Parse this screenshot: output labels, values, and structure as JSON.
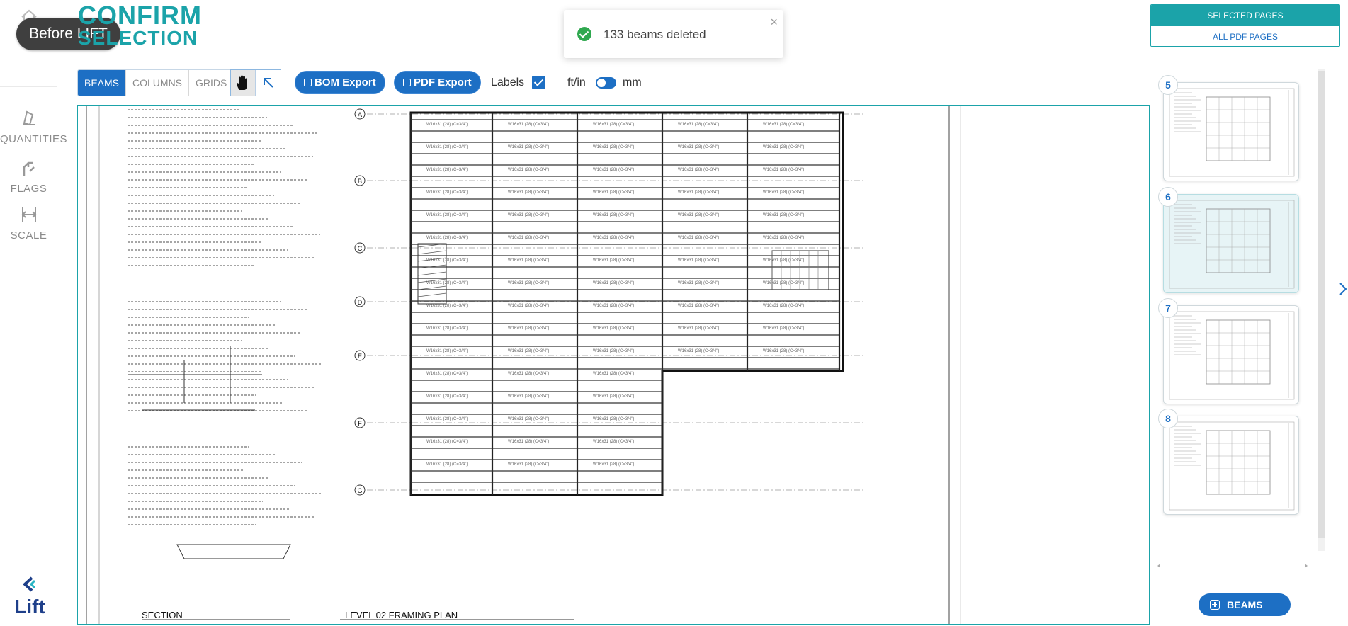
{
  "app": {
    "badge": "Before LIFT",
    "logo_text": "Lift"
  },
  "title": {
    "line1": "CONFIRM",
    "line2": "SELECTION"
  },
  "sidebar": {
    "items": [
      {
        "label": "QUANTITIES",
        "icon": "quantities-icon"
      },
      {
        "label": "FLAGS",
        "icon": "flags-icon"
      },
      {
        "label": "SCALE",
        "icon": "scale-icon"
      }
    ]
  },
  "toast": {
    "message": "133 beams deleted",
    "close": "×"
  },
  "toolbar": {
    "tabs": [
      {
        "label": "BEAMS",
        "active": true
      },
      {
        "label": "COLUMNS",
        "active": false
      },
      {
        "label": "GRIDS",
        "active": false
      }
    ],
    "bom_export": "BOM Export",
    "pdf_export": "PDF Export",
    "labels": "Labels",
    "labels_checked": true,
    "unit_left": "ft/in",
    "unit_right": "mm"
  },
  "drawing": {
    "section_caption": "SECTION",
    "plan_caption": "LEVEL 02 FRAMING PLAN",
    "grid_rows": [
      "A",
      "B",
      "C",
      "D",
      "E",
      "F",
      "G"
    ],
    "beam_label": "W16x31 (28) (C=3/4\")"
  },
  "right_panel": {
    "selected_pages": "SELECTED PAGES",
    "all_pdf_pages": "ALL PDF PAGES",
    "pages": [
      {
        "number": "5",
        "active": false
      },
      {
        "number": "6",
        "active": true
      },
      {
        "number": "7",
        "active": false
      },
      {
        "number": "8",
        "active": false
      }
    ],
    "beams_button": "BEAMS"
  },
  "colors": {
    "brand_teal": "#1ba3a9",
    "primary_blue": "#1d6fc4",
    "toast_success": "#2fa84f"
  }
}
